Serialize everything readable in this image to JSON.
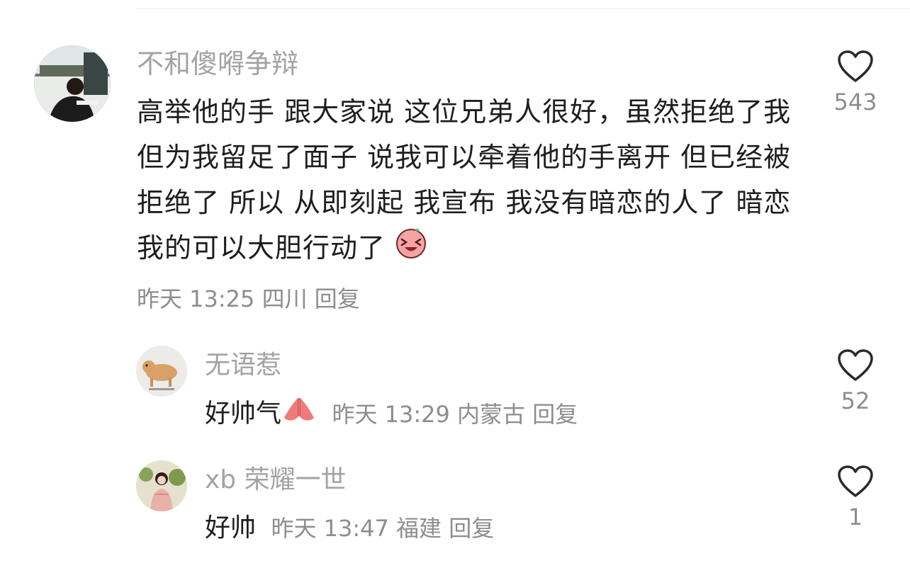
{
  "comment": {
    "username": "不和傻嘚争辩",
    "text": "高举他的手  跟大家说  这位兄弟人很好，虽然拒绝了我 但为我留足了面子 说我可以牵着他的手离开  但已经被拒绝了  所以 从即刻起 我宣布  我没有暗恋的人了  暗恋我的可以大胆行动了",
    "text_emoji": "laughing-face-emoji",
    "time": "昨天 13:25",
    "location": "四川",
    "reply_label": "回复",
    "likes": "543"
  },
  "replies": [
    {
      "username": "无语惹",
      "text": "好帅气",
      "text_emoji": "praying-hands-emoji",
      "time": "昨天 13:29",
      "location": "内蒙古",
      "reply_label": "回复",
      "likes": "52"
    },
    {
      "username": "xb 荣耀一世",
      "text": "好帅",
      "time": "昨天 13:47",
      "location": "福建",
      "reply_label": "回复",
      "likes": "1"
    }
  ],
  "colors": {
    "username": "#a3a3a3",
    "meta": "#8d8d8d",
    "text": "#1e1e1e",
    "heart_outline": "#2b2b2b"
  }
}
